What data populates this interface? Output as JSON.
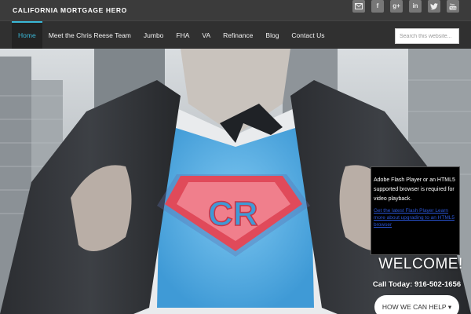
{
  "header": {
    "brand": "CALIFORNIA MORTGAGE HERO",
    "social": [
      {
        "name": "mail-icon"
      },
      {
        "name": "facebook-icon",
        "glyph": "f"
      },
      {
        "name": "google-plus-icon",
        "glyph": "g+"
      },
      {
        "name": "linkedin-icon",
        "glyph": "in"
      },
      {
        "name": "twitter-icon"
      },
      {
        "name": "youtube-icon"
      }
    ]
  },
  "nav": {
    "items": [
      "Home",
      "Meet the Chris Reese Team",
      "Jumbo",
      "FHA",
      "VA",
      "Refinance",
      "Blog",
      "Contact Us"
    ],
    "active": "Home",
    "search_placeholder": "Search this website..."
  },
  "hero": {
    "video_message": "Adobe Flash Player or an HTML5 supported browser is required for video playback.",
    "video_link": "Get the latest Flash Player Learn more about upgrading to an HTML5 browser",
    "welcome": "WELCOME!",
    "phone": "Call Today: 916-502-1656",
    "cta": "HOW WE CAN HELP ▾",
    "logo_letters": "CR"
  },
  "colors": {
    "accent": "#3ab7d6",
    "topbar": "#3b3b3b",
    "navbar": "#303030",
    "shirt_blue": "#4aa8e0",
    "emblem_red": "#e04a5a"
  }
}
